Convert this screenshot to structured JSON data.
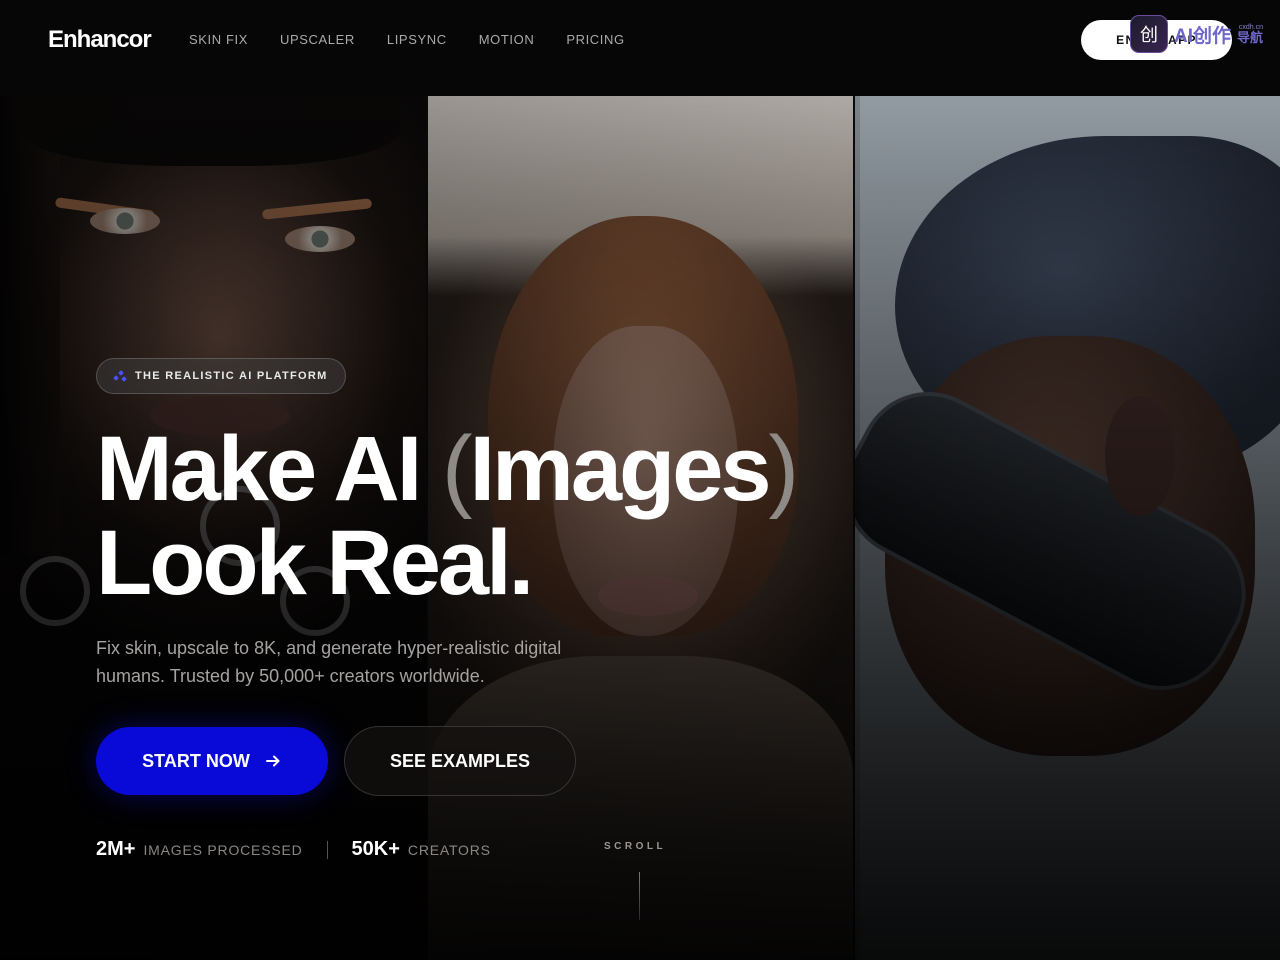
{
  "nav": {
    "logo": "Enhancor",
    "links": [
      "SKIN FIX",
      "UPSCALER",
      "LIPSYNC",
      "MOTION",
      "PRICING"
    ],
    "cta": "ENTER APP"
  },
  "watermark": {
    "text": "AI创作",
    "sub_small": "cxdh.cn",
    "sub": "导航",
    "badge_glyph": "创"
  },
  "hero": {
    "badge": "THE REALISTIC AI PLATFORM",
    "headline_part1": "Make AI ",
    "paren_open": "(",
    "headline_emph": "Images",
    "paren_close": ")",
    "headline_line2": "Look Real.",
    "subtitle": "Fix skin, upscale to 8K, and generate hyper-realistic digital humans. Trusted by 50,000+ creators worldwide.",
    "start_button": "START NOW",
    "examples_button": "SEE EXAMPLES",
    "stats": [
      {
        "value": "2M+",
        "label": "IMAGES PROCESSED"
      },
      {
        "value": "50K+",
        "label": "CREATORS"
      }
    ],
    "scroll_label": "SCROLL"
  },
  "colors": {
    "accent": "#0a0ad8",
    "background": "#050505",
    "muted_text": "#a5a2a0"
  }
}
